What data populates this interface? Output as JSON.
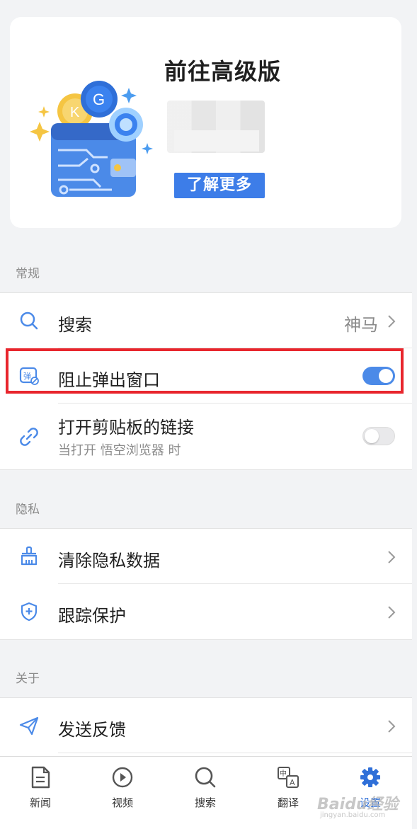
{
  "promo": {
    "title": "前往高级版",
    "button_label": "了解更多"
  },
  "sections": {
    "general": "常规",
    "privacy": "隐私",
    "about": "关于"
  },
  "general_rows": {
    "search_label": "搜索",
    "search_value": "神马",
    "popup_label": "阻止弹出窗口",
    "popup_enabled": true,
    "clipboard_label": "打开剪贴板的链接",
    "clipboard_sub": "当打开 悟空浏览器 时",
    "clipboard_enabled": false
  },
  "privacy_rows": {
    "clear_label": "清除隐私数据",
    "tracking_label": "跟踪保护"
  },
  "about_rows": {
    "feedback_label": "发送反馈"
  },
  "tabs": [
    {
      "label": "新闻",
      "icon": "news-icon"
    },
    {
      "label": "视频",
      "icon": "video-play-icon"
    },
    {
      "label": "搜索",
      "icon": "search-icon"
    },
    {
      "label": "翻译",
      "icon": "translate-icon"
    },
    {
      "label": "设置",
      "icon": "gear-icon",
      "active": true
    }
  ],
  "watermark": {
    "brand": "Baidu经验",
    "url": "jingyan.baidu.com"
  },
  "colors": {
    "accent": "#4b8ae8",
    "tab_active": "#2f6fd8",
    "highlight_border": "#e8262d"
  }
}
